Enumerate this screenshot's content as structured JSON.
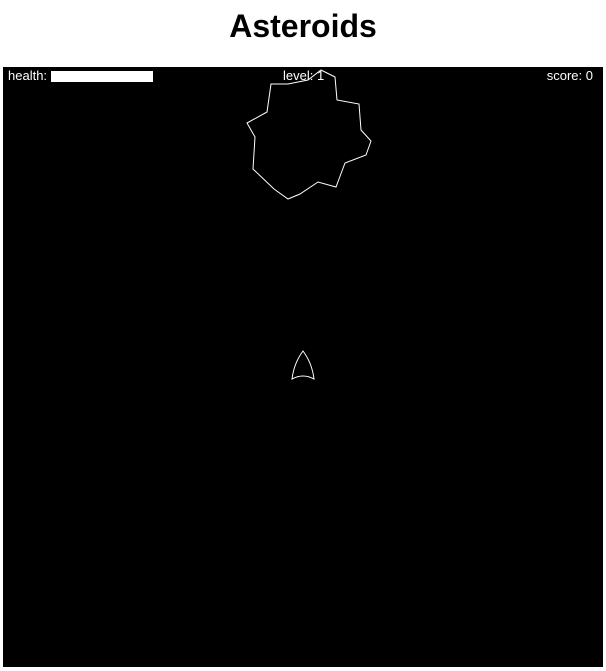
{
  "page": {
    "title": "Asteroids"
  },
  "hud": {
    "health_label": "health:",
    "health_value": 1.0,
    "level_label": "level:",
    "level_value": "1",
    "score_label": "score:",
    "score_value": "0"
  },
  "colors": {
    "background": "#000000",
    "foreground": "#ffffff"
  },
  "entities": {
    "asteroid": "asteroid-outline",
    "ship": "player-ship"
  }
}
